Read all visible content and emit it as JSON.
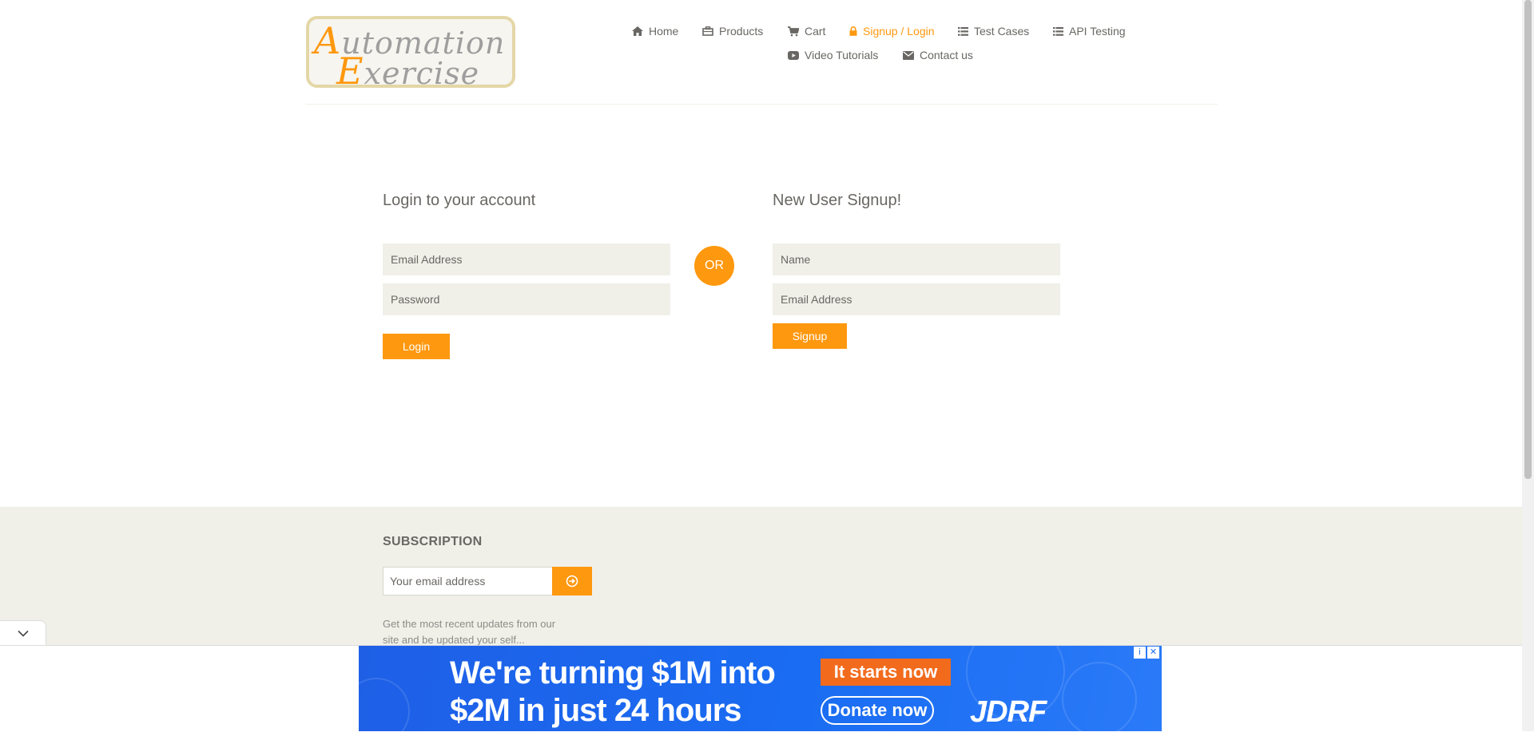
{
  "brand": {
    "logo_line1_cap": "A",
    "logo_line1_rest": "utomation",
    "logo_line2_cap": "E",
    "logo_line2_rest": "xercise"
  },
  "nav": {
    "home": "Home",
    "products": "Products",
    "cart": "Cart",
    "signup_login": "Signup / Login",
    "test_cases": "Test Cases",
    "api_testing": "API Testing",
    "video_tutorials": "Video Tutorials",
    "contact_us": "Contact us"
  },
  "login": {
    "title": "Login to your account",
    "email_placeholder": "Email Address",
    "password_placeholder": "Password",
    "button": "Login"
  },
  "divider": "OR",
  "signup": {
    "title": "New User Signup!",
    "name_placeholder": "Name",
    "email_placeholder": "Email Address",
    "button": "Signup"
  },
  "subscription": {
    "title": "SUBSCRIPTION",
    "placeholder": "Your email address",
    "description": "Get the most recent updates from our site and be updated your self..."
  },
  "ad": {
    "line1": "We're turning $1M into",
    "line2": "$2M in just 24 hours",
    "cta1": "It starts now",
    "cta2": "Donate now",
    "brand": "JDRF",
    "info": "i",
    "close": "✕"
  },
  "colors": {
    "accent": "#fe980f",
    "text": "#696763",
    "field_bg": "#f0f0e9",
    "ad_blue": "#1a6cf2"
  },
  "icons": [
    "home-icon",
    "products-icon",
    "cart-icon",
    "lock-icon",
    "list-icon",
    "list-icon",
    "youtube-icon",
    "envelope-icon",
    "arrow-circle-right-icon",
    "chevron-down-icon"
  ]
}
